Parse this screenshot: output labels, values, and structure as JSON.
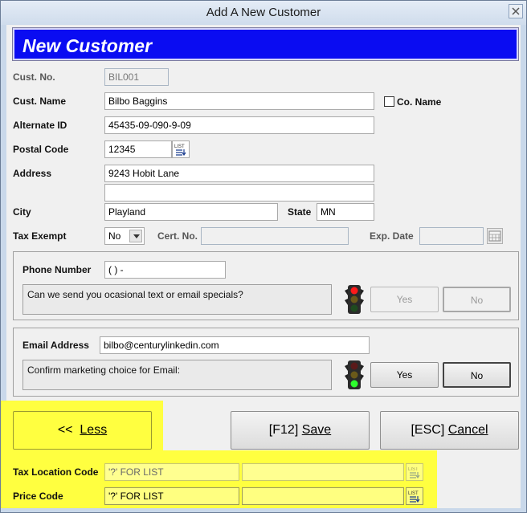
{
  "window": {
    "title": "Add A New Customer"
  },
  "banner": {
    "title": "New Customer"
  },
  "fields": {
    "cust_no": {
      "label": "Cust. No.",
      "value": "BIL001"
    },
    "cust_name": {
      "label": "Cust. Name",
      "value": "Bilbo Baggins"
    },
    "co_name": {
      "label": "Co. Name",
      "checked": false
    },
    "alternate_id": {
      "label": "Alternate ID",
      "value": "45435-09-090-9-09"
    },
    "postal_code": {
      "label": "Postal Code",
      "value": "12345"
    },
    "address": {
      "label": "Address",
      "line1": "9243 Hobit Lane",
      "line2": ""
    },
    "city": {
      "label": "City",
      "value": "Playland"
    },
    "state": {
      "label": "State",
      "value": "MN"
    },
    "tax_exempt": {
      "label": "Tax Exempt",
      "value": "No"
    },
    "cert_no": {
      "label": "Cert. No.",
      "value": ""
    },
    "exp_date": {
      "label": "Exp. Date",
      "value": ""
    }
  },
  "phone_group": {
    "label": "Phone Number",
    "value": "(  )   -",
    "question": "Can we send you ocasional text or email specials?",
    "yes": "Yes",
    "no": "No"
  },
  "email_group": {
    "label": "Email Address",
    "value": "bilbo@centurylinkedin.com",
    "question": "Confirm marketing choice for Email:",
    "yes": "Yes",
    "no": "No"
  },
  "buttons": {
    "less_prefix": "<<",
    "less": "Less",
    "save_prefix": "[F12]",
    "save": "Save",
    "cancel_prefix": "[ESC]",
    "cancel": "Cancel"
  },
  "extra": {
    "tax_location": {
      "label": "Tax Location Code",
      "value": "'?' FOR LIST",
      "desc": ""
    },
    "price_code": {
      "label": "Price Code",
      "value": "'?' FOR LIST",
      "desc": ""
    }
  },
  "colors": {
    "banner": "#0a0cf2",
    "highlight": "#ffff40"
  }
}
